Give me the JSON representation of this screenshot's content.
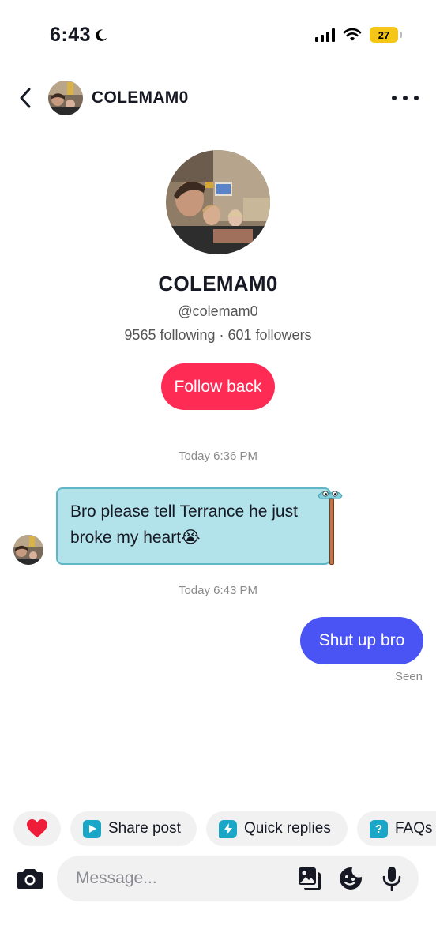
{
  "status_bar": {
    "time": "6:43",
    "battery": "27"
  },
  "header": {
    "username": "COLEMAM0"
  },
  "profile": {
    "display_name": "COLEMAM0",
    "handle": "@colemam0",
    "stats": "9565 following · 601 followers",
    "follow_button": "Follow back"
  },
  "messages": [
    {
      "timestamp": "Today 6:36 PM",
      "direction": "received",
      "text": "Bro please tell Terrance he just broke my heart😭"
    },
    {
      "timestamp": "Today 6:43 PM",
      "direction": "sent",
      "text": "Shut up bro",
      "status": "Seen"
    }
  ],
  "quick_actions": {
    "heart_icon": "heart-icon",
    "share_post": "Share post",
    "quick_replies": "Quick replies",
    "faqs": "FAQs"
  },
  "composer": {
    "placeholder": "Message..."
  },
  "colors": {
    "follow_button": "#fe2c55",
    "sent_bubble": "#4a54f5",
    "received_bubble": "#b3e3ea",
    "chip_icon": "#1aa6c7",
    "battery": "#f5c518"
  }
}
